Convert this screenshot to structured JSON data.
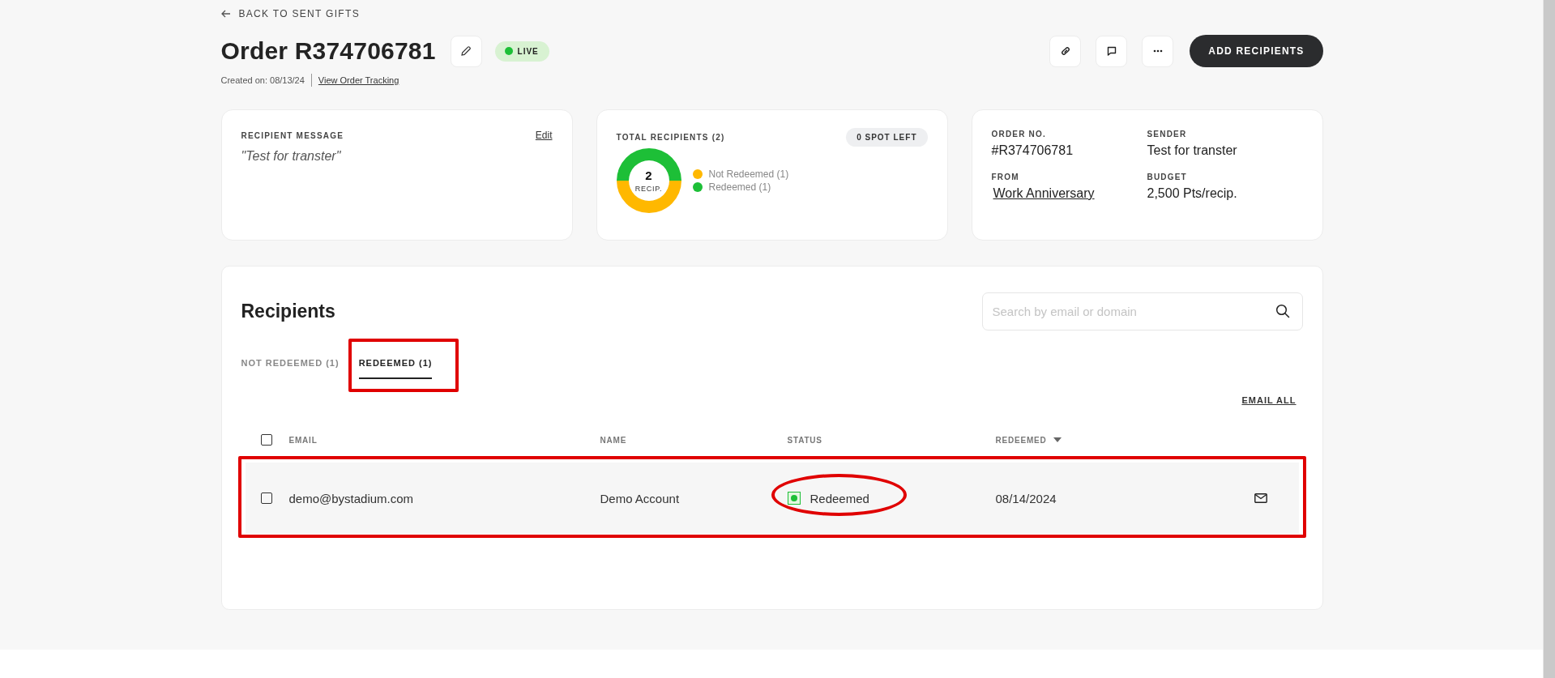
{
  "back_link": {
    "label": "BACK TO SENT GIFTS"
  },
  "header": {
    "title": "Order R374706781",
    "status_badge": {
      "label": "LIVE",
      "live": true
    },
    "created": "Created on: 08/13/24",
    "tracking_link": "View Order Tracking",
    "icon_buttons": [
      {
        "kind": "link"
      },
      {
        "kind": "comment"
      },
      {
        "kind": "more"
      }
    ],
    "primary_button": "ADD RECIPIENTS"
  },
  "message_card": {
    "label": "RECIPIENT MESSAGE",
    "edit": "Edit",
    "message": "\"Test for transter\""
  },
  "recipients_card": {
    "label": "TOTAL RECIPIENTS (2)",
    "badge": "0 SPOT LEFT",
    "center_value": "2",
    "center_label": "RECIP.",
    "legend": [
      {
        "color": "#ffb800"
      },
      {
        "color": "#1dbf37"
      }
    ],
    "chart_data": {
      "type": "donut",
      "categories": [
        "Not Redeemed (1)",
        "Redeemed (1)"
      ],
      "values": [
        50,
        50
      ]
    }
  },
  "details_card": {
    "fields": [
      {
        "label": "ORDER NO.",
        "value": "#R374706781",
        "kind": "text"
      },
      {
        "label": "SENDER",
        "value": "Test for transter",
        "kind": "text"
      },
      {
        "label": "FROM",
        "value": "Work Anniversary",
        "kind": "link"
      },
      {
        "label": "BUDGET",
        "value": "2,500 Pts/recip.",
        "kind": "text"
      }
    ]
  },
  "recipients": {
    "title": "Recipients",
    "search": {
      "placeholder": "Search by email or domain"
    },
    "tabs": [
      {
        "label": "NOT REDEEMED (1)",
        "selected": false,
        "highlighted": false
      },
      {
        "label": "REDEEMED (1)",
        "selected": true,
        "highlighted": true
      }
    ],
    "email_all": "EMAIL ALL",
    "table": {
      "select_all": {
        "checked": false
      },
      "columns": [
        {
          "label": "EMAIL",
          "sorted": false
        },
        {
          "label": "NAME",
          "sorted": false
        },
        {
          "label": "STATUS",
          "sorted": false
        },
        {
          "label": "REDEEMED",
          "sorted": true
        }
      ],
      "rows": [
        {
          "checked": false,
          "highlighted": true,
          "email": "demo@bystadium.com",
          "name": "Demo Account",
          "status": {
            "label": "Redeemed",
            "redeemed": true,
            "circled": true
          },
          "redeemed": "08/14/2024"
        }
      ]
    }
  }
}
